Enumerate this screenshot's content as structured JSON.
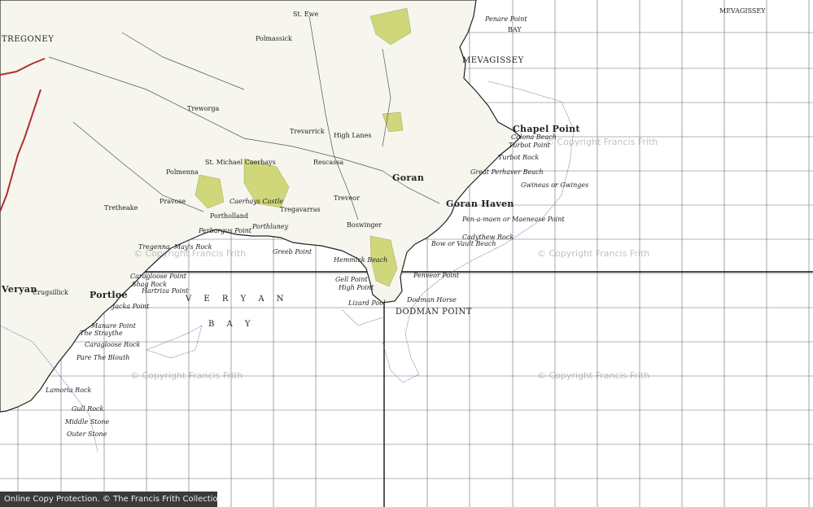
{
  "map": {
    "places": [
      {
        "id": "tregoney",
        "text": "TREGONEY",
        "style": "caps"
      },
      {
        "id": "mevagissey",
        "text": "MEVAGISSEY",
        "style": "caps"
      },
      {
        "id": "mevagissey-bay-1",
        "text": "MEVAGISSEY",
        "style": "normal"
      },
      {
        "id": "mevagissey-bay-2",
        "text": "BAY",
        "style": "normal"
      },
      {
        "id": "penare-point",
        "text": "Penare Point",
        "style": "it"
      },
      {
        "id": "chapel-point",
        "text": "Chapel Point",
        "style": "big"
      },
      {
        "id": "colona-beach",
        "text": "Colona Beach",
        "style": "it"
      },
      {
        "id": "turbot-point",
        "text": "Turbot Point",
        "style": "it"
      },
      {
        "id": "turbot-rock",
        "text": "Turbot Rock",
        "style": "it"
      },
      {
        "id": "great-perhaver",
        "text": "Great Perhaver Beach",
        "style": "it"
      },
      {
        "id": "gwineas",
        "text": "Gwineas or Gwinges",
        "style": "it"
      },
      {
        "id": "goran-haven",
        "text": "Goran Haven",
        "style": "big"
      },
      {
        "id": "pen-a-maen",
        "text": "Pen-a-maen or Maenease Point",
        "style": "it"
      },
      {
        "id": "cadythew",
        "text": "Cadythew Rock",
        "style": "it"
      },
      {
        "id": "bow-or-vault",
        "text": "Bow or Vault Beach",
        "style": "it"
      },
      {
        "id": "penveor",
        "text": "Penveor Point",
        "style": "it"
      },
      {
        "id": "dodman-horse",
        "text": "Dodman Horse",
        "style": "it"
      },
      {
        "id": "dodman-point",
        "text": "DODMAN POINT",
        "style": "caps"
      },
      {
        "id": "gell-point",
        "text": "Gell Point",
        "style": "it"
      },
      {
        "id": "high-point",
        "text": "High Point",
        "style": "it"
      },
      {
        "id": "lizard-pool",
        "text": "Lizard Pool",
        "style": "it"
      },
      {
        "id": "hemmick",
        "text": "Hemmick Beach",
        "style": "it"
      },
      {
        "id": "greeb-point",
        "text": "Greeb Point",
        "style": "it"
      },
      {
        "id": "boswinger",
        "text": "Boswinger",
        "style": "normal"
      },
      {
        "id": "treveor",
        "text": "Treveor",
        "style": "normal"
      },
      {
        "id": "tregavarras",
        "text": "Tregavarras",
        "style": "normal"
      },
      {
        "id": "goran",
        "text": "Goran",
        "style": "big"
      },
      {
        "id": "high-lanes",
        "text": "High Lanes",
        "style": "normal"
      },
      {
        "id": "rescassa",
        "text": "Rescassa",
        "style": "normal"
      },
      {
        "id": "st-michael-caerhays",
        "text": "St. Michael Caerhays",
        "style": "normal"
      },
      {
        "id": "caerhays-castle",
        "text": "Caerhays Castle",
        "style": "it"
      },
      {
        "id": "porthluney",
        "text": "Porthluney",
        "style": "it"
      },
      {
        "id": "portholland",
        "text": "Portholland",
        "style": "normal"
      },
      {
        "id": "perbargus",
        "text": "Perbargus Point",
        "style": "it"
      },
      {
        "id": "tregenna",
        "text": "Tregenna",
        "style": "it"
      },
      {
        "id": "mays-rock",
        "text": "May's Rock",
        "style": "it"
      },
      {
        "id": "caragloose-point",
        "text": "Caragloose Point",
        "style": "it"
      },
      {
        "id": "shag-rock",
        "text": "Shag Rock",
        "style": "it"
      },
      {
        "id": "hartriza",
        "text": "Hartriza Point",
        "style": "it"
      },
      {
        "id": "jacka-point",
        "text": "Jacka Point",
        "style": "it"
      },
      {
        "id": "manare-point",
        "text": "Manare Point",
        "style": "it"
      },
      {
        "id": "the-straythe",
        "text": "The Straythe",
        "style": "it"
      },
      {
        "id": "caragloose-rock",
        "text": "Caragloose Rock",
        "style": "it"
      },
      {
        "id": "blouth",
        "text": "Pare The Blouth",
        "style": "it"
      },
      {
        "id": "lamoria",
        "text": "Lamoria Rock",
        "style": "it"
      },
      {
        "id": "gull-rock",
        "text": "Gull Rock",
        "style": "it"
      },
      {
        "id": "middle-stone",
        "text": "Middle Stone",
        "style": "it"
      },
      {
        "id": "outer-stone",
        "text": "Outer Stone",
        "style": "it"
      },
      {
        "id": "veryan",
        "text": "Veryan",
        "style": "big"
      },
      {
        "id": "portloe",
        "text": "Portloe",
        "style": "big"
      },
      {
        "id": "polmassick",
        "text": "Polmassick",
        "style": "normal"
      },
      {
        "id": "st-ewe",
        "text": "St. Ewe",
        "style": "normal"
      },
      {
        "id": "trevarrick",
        "text": "Trevarrick",
        "style": "normal"
      },
      {
        "id": "tregony-road",
        "text": "Treworga",
        "style": "normal"
      },
      {
        "id": "crugsillick",
        "text": "Crugsillick",
        "style": "normal"
      },
      {
        "id": "tretheake",
        "text": "Tretheake",
        "style": "normal"
      },
      {
        "id": "polmenna",
        "text": "Polmenna",
        "style": "normal"
      },
      {
        "id": "pravose",
        "text": "Pravose",
        "style": "normal"
      }
    ],
    "sea_name": [
      "V E R Y A N",
      "B A Y"
    ],
    "watermarks": [
      "© Copyright Francis Frith",
      "© Copyright Francis Frith",
      "© Copyright Francis Frith",
      "© Copyright Francis Frith",
      "© Copyright Francis Frith"
    ],
    "footer": "Online Copy Protection. © The Francis Frith Collection",
    "colors": {
      "land": "#f6f5ee",
      "woods": "#cfd77a",
      "road": "#b03030",
      "grid": "#6a6a6a",
      "coast": "#222222",
      "contour": "#4d6fa3"
    }
  }
}
